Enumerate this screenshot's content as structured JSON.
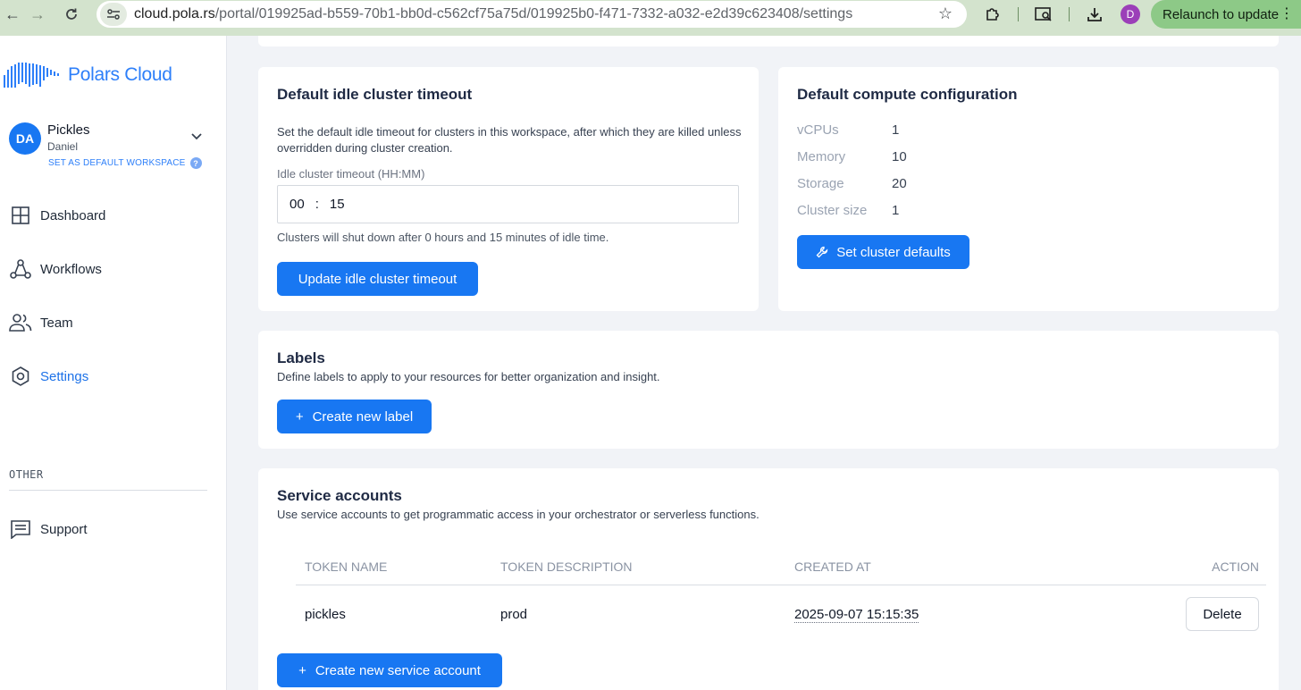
{
  "browser": {
    "url_host": "cloud.pola.rs",
    "url_path": "/portal/019925ad-b559-70b1-bb0d-c562cf75a75d/019925b0-f471-7332-a032-e2d39c623408/settings",
    "profile_initial": "D",
    "relaunch_label": "Relaunch to update"
  },
  "sidebar": {
    "logo_text": "Polars Cloud",
    "workspace": {
      "initials": "DA",
      "name": "Pickles",
      "user": "Daniel",
      "set_default": "SET AS DEFAULT WORKSPACE"
    },
    "nav": [
      {
        "label": "Dashboard",
        "icon": "dashboard-icon"
      },
      {
        "label": "Workflows",
        "icon": "workflows-icon"
      },
      {
        "label": "Team",
        "icon": "team-icon"
      },
      {
        "label": "Settings",
        "icon": "settings-icon",
        "active": true
      }
    ],
    "other_label": "OTHER",
    "support_label": "Support"
  },
  "idle_timeout": {
    "title": "Default idle cluster timeout",
    "description": "Set the default idle timeout for clusters in this workspace, after which they are killed unless overridden during cluster creation.",
    "field_label": "Idle cluster timeout (HH:MM)",
    "hours": "00",
    "minutes": "15",
    "hint": "Clusters will shut down after 0 hours and 15 minutes of idle time.",
    "button": "Update idle cluster timeout"
  },
  "compute": {
    "title": "Default compute configuration",
    "rows": [
      {
        "key": "vCPUs",
        "value": "1"
      },
      {
        "key": "Memory",
        "value": "10"
      },
      {
        "key": "Storage",
        "value": "20"
      },
      {
        "key": "Cluster size",
        "value": "1"
      }
    ],
    "button": "Set cluster defaults"
  },
  "labels": {
    "title": "Labels",
    "description": "Define labels to apply to your resources for better organization and insight.",
    "button": "Create new label"
  },
  "service_accounts": {
    "title": "Service accounts",
    "description": "Use service accounts to get programmatic access in your orchestrator or serverless functions.",
    "columns": [
      "TOKEN NAME",
      "TOKEN DESCRIPTION",
      "CREATED AT",
      "ACTION"
    ],
    "rows": [
      {
        "name": "pickles",
        "description": "prod",
        "created_at": "2025-09-07 15:15:35",
        "action": "Delete"
      }
    ],
    "button": "Create new service account"
  },
  "colors": {
    "primary": "#1877f2",
    "relaunch": "#8dc987",
    "chrome": "#d3e3cd"
  }
}
